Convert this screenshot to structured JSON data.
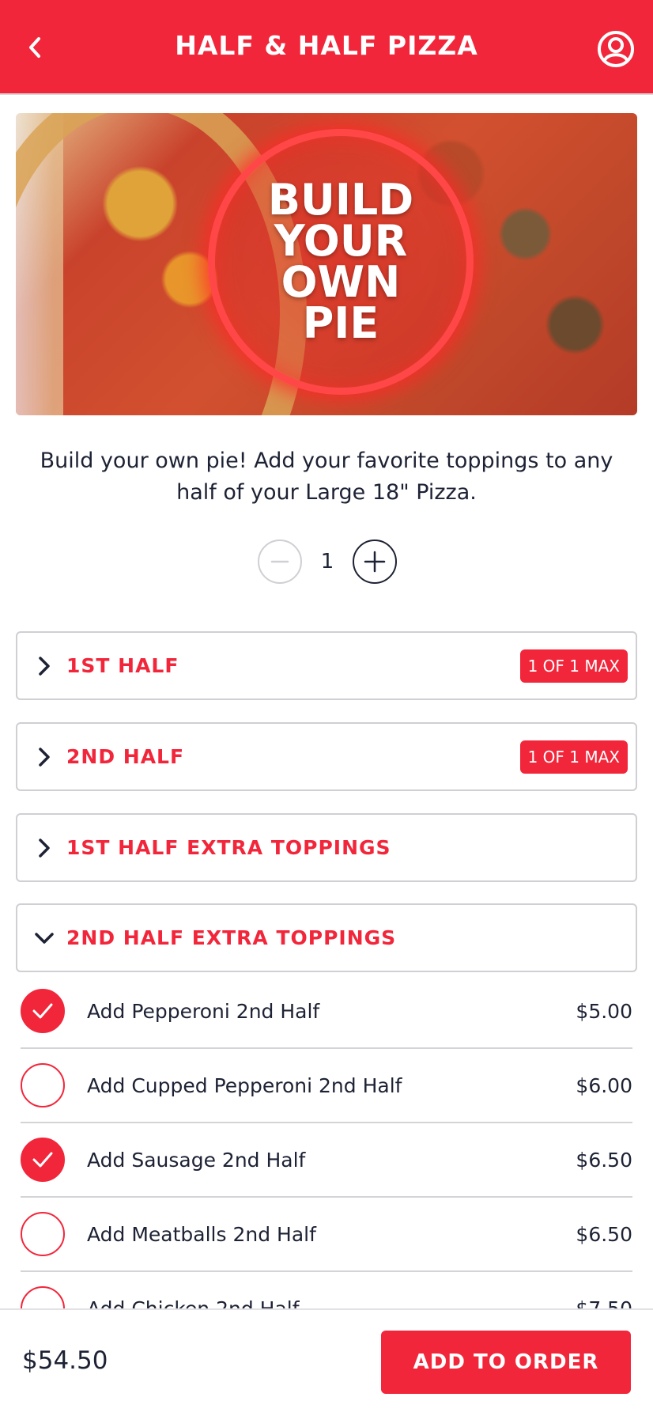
{
  "header": {
    "title": "HALF & HALF PIZZA"
  },
  "hero": {
    "badge_lines": [
      "BUILD",
      "YOUR",
      "OWN",
      "PIE"
    ]
  },
  "description": "Build your own pie! Add your favorite toppings to any half of your Large 18\" Pizza.",
  "quantity": {
    "value": "1"
  },
  "sections": [
    {
      "label": "1ST HALF",
      "badge": "1 OF 1 MAX",
      "expanded": false
    },
    {
      "label": "2ND HALF",
      "badge": "1 OF 1 MAX",
      "expanded": false
    },
    {
      "label": "1ST HALF EXTRA TOPPINGS",
      "badge": "",
      "expanded": false
    },
    {
      "label": "2ND HALF EXTRA TOPPINGS",
      "badge": "",
      "expanded": true
    }
  ],
  "options": [
    {
      "name": "Add Pepperoni 2nd Half",
      "price": "$5.00",
      "checked": true
    },
    {
      "name": "Add Cupped Pepperoni 2nd Half",
      "price": "$6.00",
      "checked": false
    },
    {
      "name": "Add Sausage 2nd Half",
      "price": "$6.50",
      "checked": true
    },
    {
      "name": "Add Meatballs 2nd Half",
      "price": "$6.50",
      "checked": false
    },
    {
      "name": "Add Chicken 2nd Half",
      "price": "$7.50",
      "checked": false
    }
  ],
  "footer": {
    "total": "$54.50",
    "add_label": "ADD TO ORDER"
  },
  "colors": {
    "brand_red": "#f2263a",
    "text_dark": "#1d2234"
  }
}
